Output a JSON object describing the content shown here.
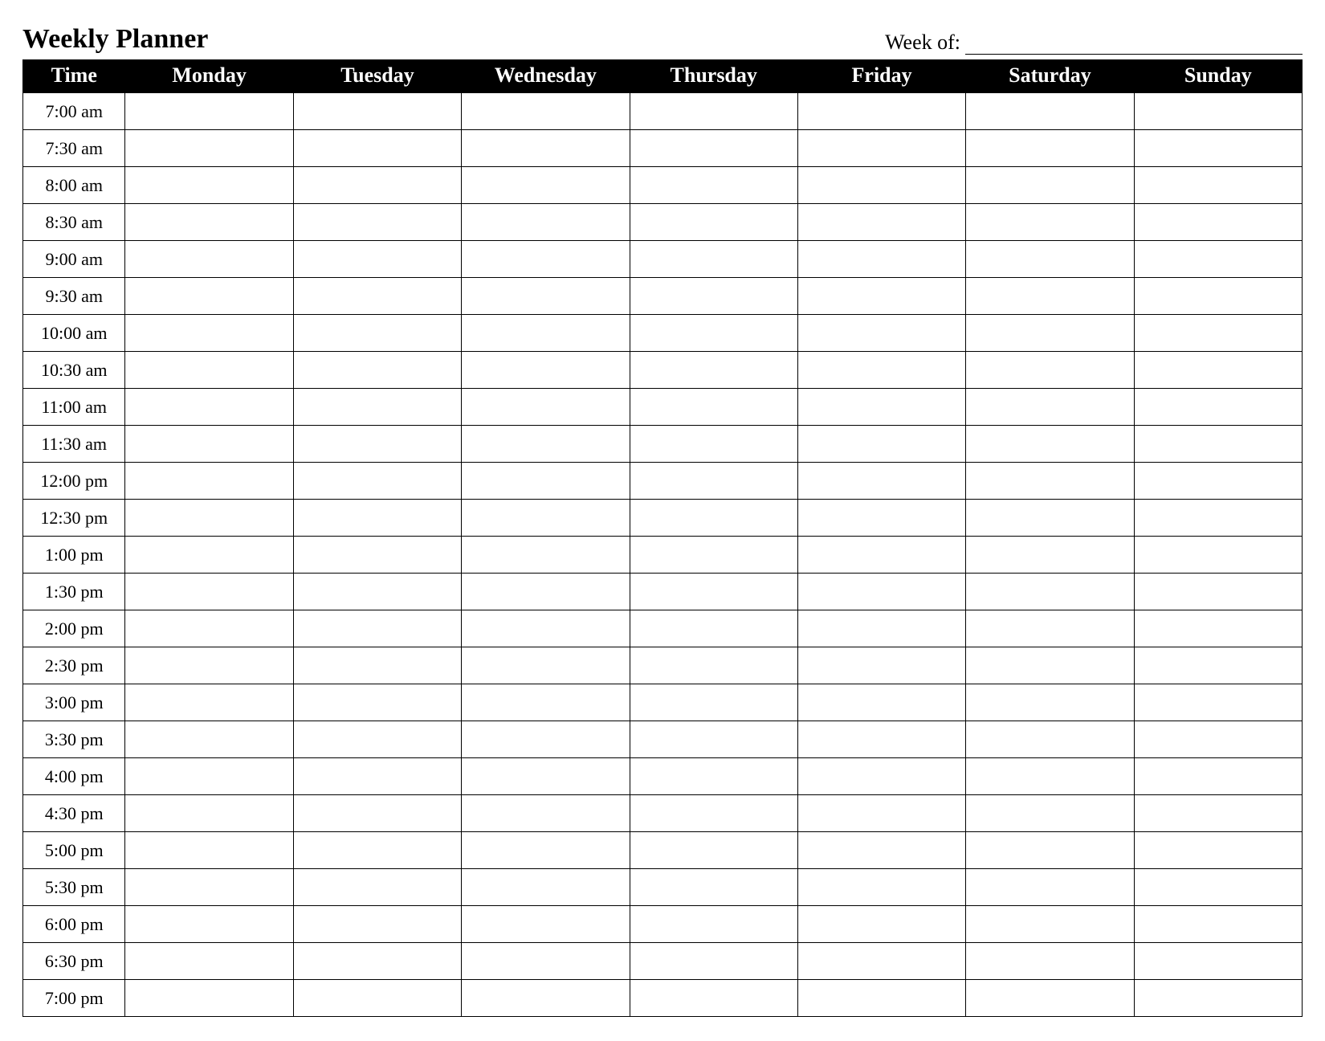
{
  "header": {
    "title": "Weekly Planner",
    "week_of_label": "Week of:",
    "week_of_value": ""
  },
  "columns": {
    "time": "Time",
    "days": [
      "Monday",
      "Tuesday",
      "Wednesday",
      "Thursday",
      "Friday",
      "Saturday",
      "Sunday"
    ]
  },
  "time_slots": [
    "7:00 am",
    "7:30 am",
    "8:00 am",
    "8:30 am",
    "9:00 am",
    "9:30 am",
    "10:00 am",
    "10:30 am",
    "11:00 am",
    "11:30 am",
    "12:00 pm",
    "12:30 pm",
    "1:00 pm",
    "1:30 pm",
    "2:00 pm",
    "2:30 pm",
    "3:00 pm",
    "3:30 pm",
    "4:00 pm",
    "4:30 pm",
    "5:00 pm",
    "5:30 pm",
    "6:00 pm",
    "6:30 pm",
    "7:00 pm"
  ]
}
